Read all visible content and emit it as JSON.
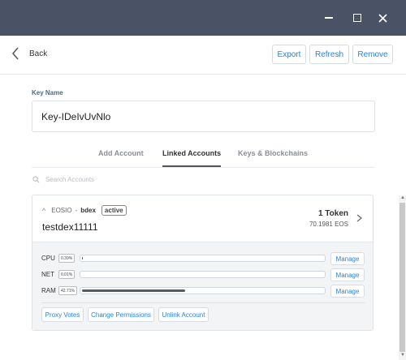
{
  "window": {
    "controls": [
      "minimize-icon",
      "maximize-icon",
      "close-icon"
    ],
    "titlebar_color": "#4a5366"
  },
  "topbar": {
    "back_label": "Back",
    "export_label": "Export",
    "refresh_label": "Refresh",
    "remove_label": "Remove"
  },
  "key": {
    "label": "Key Name",
    "value": "Key-IDeIvUvNlo"
  },
  "tabs": [
    {
      "label": "Add Account",
      "active": false
    },
    {
      "label": "Linked Accounts",
      "active": true
    },
    {
      "label": "Keys & Blockchains",
      "active": false
    }
  ],
  "search": {
    "placeholder": "Search Accounts"
  },
  "account": {
    "blockchain": "EOSIO",
    "separator": "-",
    "permission": "bdex",
    "status": "active",
    "name": "testdex11111",
    "tokens": "1 Token",
    "balance": "70.1981 EOS",
    "resources": [
      {
        "label": "CPU",
        "percent": "0.39%",
        "fraction": 0.0039,
        "manage_label": "Manage"
      },
      {
        "label": "NET",
        "percent": "0.01%",
        "fraction": 0.0001,
        "manage_label": "Manage"
      },
      {
        "label": "RAM",
        "percent": "42.71%",
        "fraction": 0.4271,
        "manage_label": "Manage"
      }
    ],
    "actions": {
      "proxy_votes": "Proxy Votes",
      "change_permissions": "Change Permissions",
      "unlink_account": "Unlink Account"
    }
  },
  "colors": {
    "accent": "#2a84d6",
    "bar_fill": "#545a66"
  }
}
